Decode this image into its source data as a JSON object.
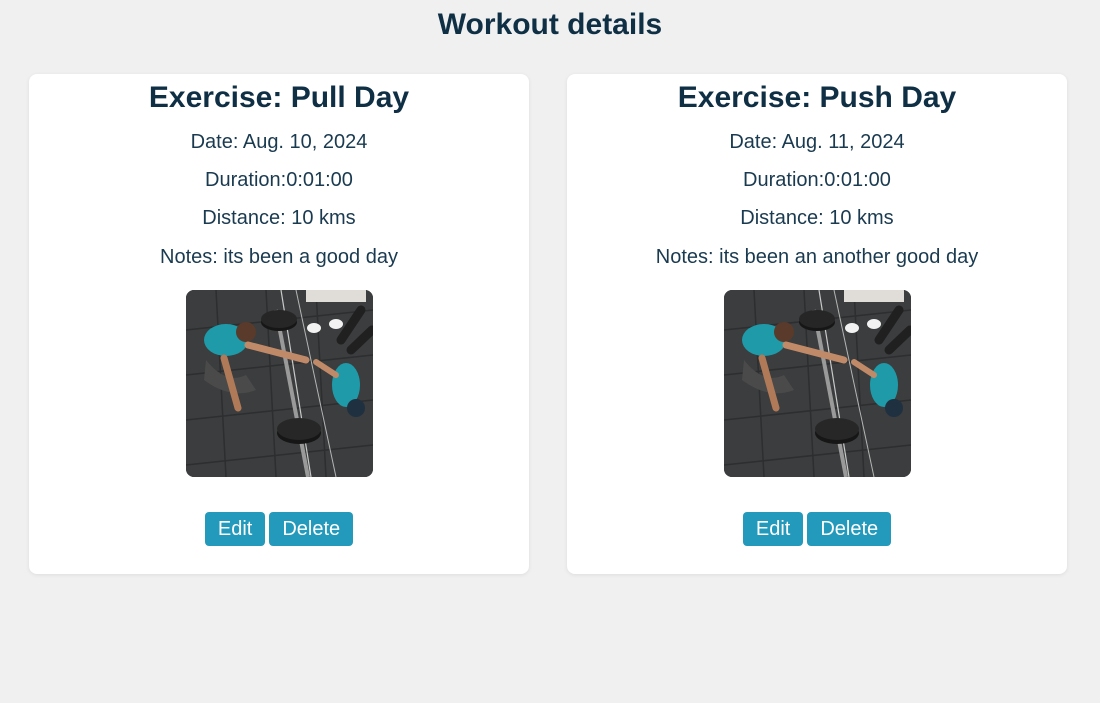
{
  "page": {
    "title": "Workout details"
  },
  "workouts": [
    {
      "exercise": "Exercise: Pull Day",
      "date": "Date: Aug. 10, 2024",
      "duration": "Duration:0:01:00",
      "distance": "Distance: 10 kms",
      "notes": "Notes: its been a good day",
      "image_alt": "workout photo",
      "edit_label": "Edit",
      "delete_label": "Delete"
    },
    {
      "exercise": "Exercise: Push Day",
      "date": "Date: Aug. 11, 2024",
      "duration": "Duration:0:01:00",
      "distance": "Distance: 10 kms",
      "notes": "Notes: its been an another good day",
      "image_alt": "workout photo",
      "edit_label": "Edit",
      "delete_label": "Delete"
    }
  ],
  "colors": {
    "background": "#f0f0f0",
    "card": "#ffffff",
    "heading": "#0f2f45",
    "button": "#2399bb",
    "button_text": "#ffffff"
  }
}
